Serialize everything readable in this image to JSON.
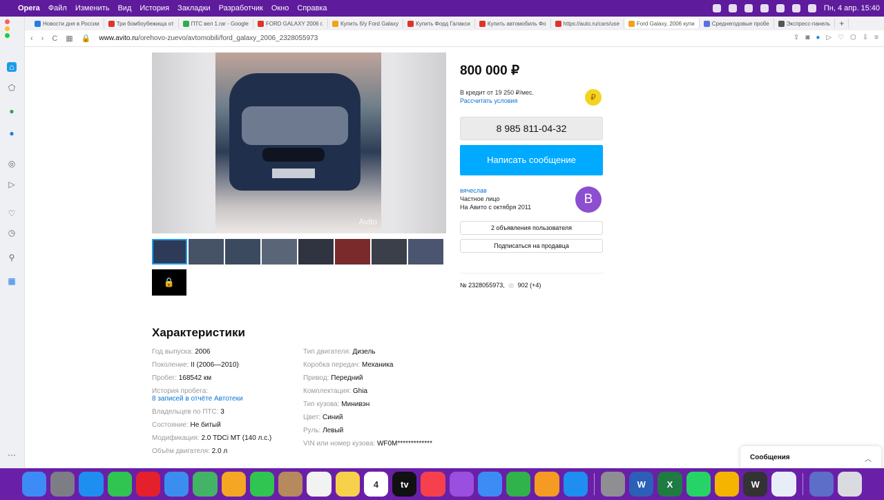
{
  "menubar": {
    "app": "Opera",
    "items": [
      "Файл",
      "Изменить",
      "Вид",
      "История",
      "Закладки",
      "Разработчик",
      "Окно",
      "Справка"
    ],
    "clock": "Пн, 4 апр. 15:40"
  },
  "tabs": [
    {
      "label": "Новости дня в России",
      "color": "#2a7be4"
    },
    {
      "label": "Три бомбоубежища от",
      "color": "#e0332b"
    },
    {
      "label": "ПТС вел 1.rar - Google",
      "color": "#34a853"
    },
    {
      "label": "FORD GALAXY 2006 г.",
      "color": "#e0332b"
    },
    {
      "label": "Купить б/у Ford Galaxy",
      "color": "#f3a11a"
    },
    {
      "label": "Купить Форд Галакси",
      "color": "#e0332b"
    },
    {
      "label": "Купить автомобиль Фо",
      "color": "#e0332b"
    },
    {
      "label": "https://auto.ru/cars/use",
      "color": "#e0332b"
    },
    {
      "label": "Ford Galaxy, 2006 купи",
      "color": "#f3a11a"
    },
    {
      "label": "Среднегодовые пробе",
      "color": "#5b6ee1"
    },
    {
      "label": "Экспресс-панель",
      "color": "#555555"
    }
  ],
  "address": {
    "domain": "www.avito.ru",
    "path": "/orehovo-zuevo/avtomobili/ford_galaxy_2006_2328055973"
  },
  "gallery": {
    "watermark": "Avito",
    "thumbs": [
      1,
      2,
      3,
      4,
      5,
      6,
      7,
      8
    ]
  },
  "listing": {
    "price": "800 000 ₽",
    "credit_line": "В кредит от 19 250 ₽/мес.",
    "credit_link": "Рассчитать условия",
    "phone": "8 985 811-04-32",
    "message_button": "Написать сообщение",
    "seller_name": "вячеслав",
    "seller_type": "Частное лицо",
    "seller_since": "На Авито с октября 2011",
    "seller_initial": "В",
    "user_ads_button": "2 объявления пользователя",
    "subscribe_button": "Подписаться на продавца",
    "ad_number": "№ 2328055973,",
    "views": "902 (+4)"
  },
  "specs": {
    "title": "Характеристики",
    "left": [
      {
        "k": "Год выпуска:",
        "v": "2006"
      },
      {
        "k": "Поколение:",
        "v": "II (2006—2010)"
      },
      {
        "k": "Пробег:",
        "v": "168542 км"
      },
      {
        "k": "История пробега:",
        "v": "",
        "link": "8 записей в отчёте Автотеки"
      },
      {
        "k": "Владельцев по ПТС:",
        "v": "3"
      },
      {
        "k": "Состояние:",
        "v": "Не битый"
      },
      {
        "k": "Модификация:",
        "v": "2.0 TDCi MT (140 л.с.)"
      },
      {
        "k": "Объём двигателя:",
        "v": "2.0 л"
      }
    ],
    "right": [
      {
        "k": "Тип двигателя:",
        "v": "Дизель"
      },
      {
        "k": "Коробка передач:",
        "v": "Механика"
      },
      {
        "k": "Привод:",
        "v": "Передний"
      },
      {
        "k": "Комплектация:",
        "v": "Ghia"
      },
      {
        "k": "Тип кузова:",
        "v": "Минивэн"
      },
      {
        "k": "Цвет:",
        "v": "Синий"
      },
      {
        "k": "Руль:",
        "v": "Левый"
      },
      {
        "k": "VIN или номер кузова:",
        "v": "WF0M*************"
      }
    ]
  },
  "messages_panel": {
    "label": "Сообщения"
  },
  "dock": [
    {
      "name": "finder",
      "color": "#3d8bf5"
    },
    {
      "name": "launchpad",
      "color": "#7d7d86"
    },
    {
      "name": "safari",
      "color": "#1f8ef1"
    },
    {
      "name": "messages",
      "color": "#2fc550"
    },
    {
      "name": "opera",
      "color": "#e5202d"
    },
    {
      "name": "mail",
      "color": "#3b8ef0"
    },
    {
      "name": "maps",
      "color": "#43b365"
    },
    {
      "name": "photos",
      "color": "#f5a623"
    },
    {
      "name": "facetime",
      "color": "#2fc550"
    },
    {
      "name": "contacts",
      "color": "#b68a5c"
    },
    {
      "name": "reminders",
      "color": "#f2f2f2"
    },
    {
      "name": "notes",
      "color": "#f7d14a"
    },
    {
      "name": "calendar",
      "color": "#ffffff",
      "text": "4"
    },
    {
      "name": "tv",
      "color": "#111111",
      "text": "tv"
    },
    {
      "name": "music",
      "color": "#f6414c"
    },
    {
      "name": "podcasts",
      "color": "#9b4fe0"
    },
    {
      "name": "keynote",
      "color": "#3d8bf5"
    },
    {
      "name": "numbers",
      "color": "#2fb34a"
    },
    {
      "name": "pages",
      "color": "#f59a23"
    },
    {
      "name": "app-store",
      "color": "#1f8ef1"
    },
    {
      "name": "system-preferences",
      "color": "#8e8e93"
    },
    {
      "name": "word",
      "color": "#2b5fb8",
      "text": "W"
    },
    {
      "name": "excel",
      "color": "#1f7a43",
      "text": "X"
    },
    {
      "name": "whatsapp",
      "color": "#25d366"
    },
    {
      "name": "chrome",
      "color": "#f4b400"
    },
    {
      "name": "w-app",
      "color": "#333333",
      "text": "W"
    },
    {
      "name": "preview",
      "color": "#e8eef8"
    },
    {
      "name": "screenshot",
      "color": "#5c6ec7"
    },
    {
      "name": "trash",
      "color": "#d9dbe0"
    }
  ]
}
